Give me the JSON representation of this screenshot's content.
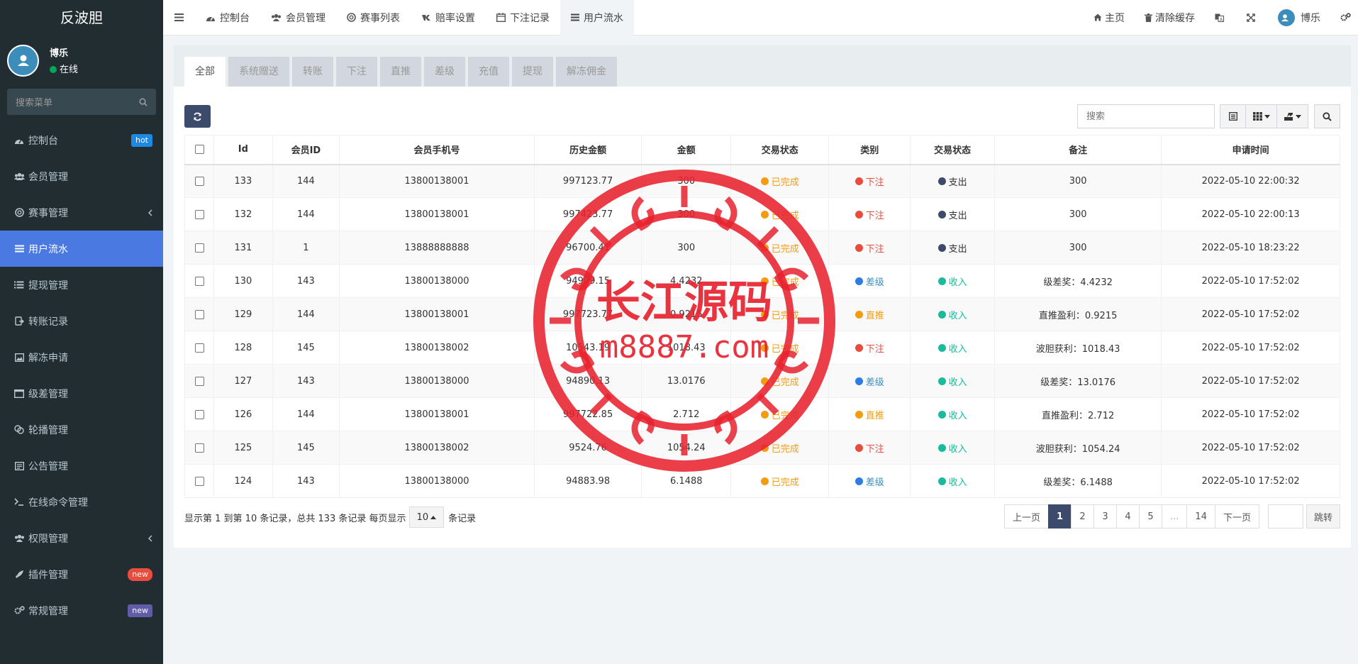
{
  "app": {
    "title": "反波胆"
  },
  "user": {
    "name": "博乐",
    "status": "在线"
  },
  "sidebar": {
    "search_placeholder": "搜索菜单",
    "items": [
      {
        "label": "控制台",
        "icon": "dashboard-icon",
        "badge": "hot"
      },
      {
        "label": "会员管理",
        "icon": "users-icon"
      },
      {
        "label": "赛事管理",
        "icon": "life-ring-icon",
        "arrow": true
      },
      {
        "label": "用户流水",
        "icon": "list-icon",
        "active": true
      },
      {
        "label": "提现管理",
        "icon": "list-alt-icon"
      },
      {
        "label": "转账记录",
        "icon": "transfer-icon"
      },
      {
        "label": "解冻申请",
        "icon": "image-icon"
      },
      {
        "label": "级差管理",
        "icon": "window-icon"
      },
      {
        "label": "轮播管理",
        "icon": "carousel-icon"
      },
      {
        "label": "公告管理",
        "icon": "notice-icon"
      },
      {
        "label": "在线命令管理",
        "icon": "terminal-icon"
      },
      {
        "label": "权限管理",
        "icon": "group-icon",
        "arrow": true
      },
      {
        "label": "插件管理",
        "icon": "rocket-icon",
        "badge": "new"
      },
      {
        "label": "常规管理",
        "icon": "cogs-icon",
        "badge": "new"
      }
    ]
  },
  "topnav": {
    "items": [
      {
        "label": "控制台",
        "icon": "dashboard-icon"
      },
      {
        "label": "会员管理",
        "icon": "users-icon"
      },
      {
        "label": "赛事列表",
        "icon": "life-ring-icon"
      },
      {
        "label": "赔率设置",
        "icon": "vk-icon"
      },
      {
        "label": "下注记录",
        "icon": "calendar-icon"
      },
      {
        "label": "用户流水",
        "icon": "list-icon",
        "active": true
      }
    ],
    "home": "主页",
    "clear_cache": "清除缓存",
    "username": "博乐"
  },
  "filter_tabs": [
    "全部",
    "系统赠送",
    "转账",
    "下注",
    "直推",
    "差级",
    "充值",
    "提现",
    "解冻佣金"
  ],
  "toolbar": {
    "search_placeholder": "搜索"
  },
  "table": {
    "headers": [
      "Id",
      "会员ID",
      "会员手机号",
      "历史金额",
      "金额",
      "交易状态",
      "类别",
      "交易状态",
      "备注",
      "申请时间"
    ],
    "rows": [
      {
        "id": "133",
        "member_id": "144",
        "phone": "13800138001",
        "history": "997123.77",
        "amount": "300",
        "status": "已完成",
        "category": "下注",
        "cat_color": "red",
        "flow": "支出",
        "flow_color": "dark",
        "remark": "300",
        "time": "2022-05-10 22:00:32"
      },
      {
        "id": "132",
        "member_id": "144",
        "phone": "13800138001",
        "history": "997423.77",
        "amount": "300",
        "status": "已完成",
        "category": "下注",
        "cat_color": "red",
        "flow": "支出",
        "flow_color": "dark",
        "remark": "300",
        "time": "2022-05-10 22:00:13"
      },
      {
        "id": "131",
        "member_id": "1",
        "phone": "13888888888",
        "history": "96700.41",
        "amount": "300",
        "status": "已完成",
        "category": "下注",
        "cat_color": "red",
        "flow": "支出",
        "flow_color": "dark",
        "remark": "300",
        "time": "2022-05-10 18:23:22"
      },
      {
        "id": "130",
        "member_id": "143",
        "phone": "13800138000",
        "history": "94909.15",
        "amount": "4.4232",
        "status": "已完成",
        "category": "差级",
        "cat_color": "blue",
        "flow": "收入",
        "flow_color": "green",
        "remark": "级差奖：4.4232",
        "time": "2022-05-10 17:52:02"
      },
      {
        "id": "129",
        "member_id": "144",
        "phone": "13800138001",
        "history": "997723.77",
        "amount": "0.9215",
        "status": "已完成",
        "category": "直推",
        "cat_color": "orange",
        "flow": "收入",
        "flow_color": "green",
        "remark": "直推盈利：0.9215",
        "time": "2022-05-10 17:52:02"
      },
      {
        "id": "128",
        "member_id": "145",
        "phone": "13800138002",
        "history": "10543.19",
        "amount": "1018.43",
        "status": "已完成",
        "category": "下注",
        "cat_color": "red",
        "flow": "收入",
        "flow_color": "green",
        "remark": "波胆获利：1018.43",
        "time": "2022-05-10 17:52:02"
      },
      {
        "id": "127",
        "member_id": "143",
        "phone": "13800138000",
        "history": "94890.13",
        "amount": "13.0176",
        "status": "已完成",
        "category": "差级",
        "cat_color": "blue",
        "flow": "收入",
        "flow_color": "green",
        "remark": "级差奖：13.0176",
        "time": "2022-05-10 17:52:02"
      },
      {
        "id": "126",
        "member_id": "144",
        "phone": "13800138001",
        "history": "997722.85",
        "amount": "2.712",
        "status": "已完成",
        "category": "直推",
        "cat_color": "orange",
        "flow": "收入",
        "flow_color": "green",
        "remark": "直推盈利：2.712",
        "time": "2022-05-10 17:52:02"
      },
      {
        "id": "125",
        "member_id": "145",
        "phone": "13800138002",
        "history": "9524.76",
        "amount": "1054.24",
        "status": "已完成",
        "category": "下注",
        "cat_color": "red",
        "flow": "收入",
        "flow_color": "green",
        "remark": "波胆获利：1054.24",
        "time": "2022-05-10 17:52:02"
      },
      {
        "id": "124",
        "member_id": "143",
        "phone": "13800138000",
        "history": "94883.98",
        "amount": "6.1488",
        "status": "已完成",
        "category": "差级",
        "cat_color": "blue",
        "flow": "收入",
        "flow_color": "green",
        "remark": "级差奖：6.1488",
        "time": "2022-05-10 17:52:02"
      }
    ]
  },
  "footer": {
    "summary": "显示第 1 到第 10 条记录，总共 133 条记录 每页显示",
    "page_size": "10",
    "suffix": "条记录"
  },
  "pagination": {
    "prev": "上一页",
    "pages": [
      "1",
      "2",
      "3",
      "4",
      "5",
      "...",
      "14"
    ],
    "current": "1",
    "next": "下一页",
    "jump": "跳转"
  },
  "watermark": {
    "line1": "长江源码",
    "line2": "m8887.com"
  },
  "colors": {
    "sidebar_bg": "#222d32",
    "active_menu": "#4a79e2",
    "primary_dark": "#3c4a6b",
    "stamp_red": "#e8232f"
  }
}
